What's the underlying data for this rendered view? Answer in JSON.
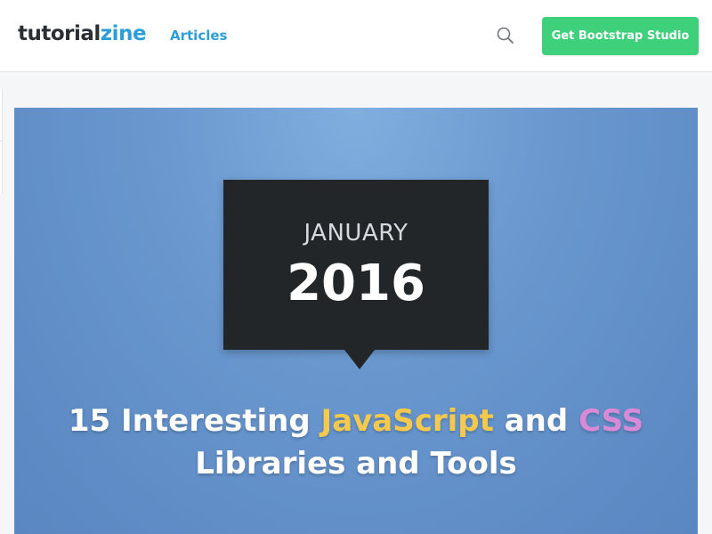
{
  "header": {
    "logo_part1": "tutorial",
    "logo_part2": "zine",
    "nav_articles": "Articles",
    "search_icon": "search-icon",
    "cta_label": "Get Bootstrap Studio"
  },
  "hero": {
    "month": "JANUARY",
    "year": "2016",
    "title_part1": "15 Interesting ",
    "title_js": "JavaScript",
    "title_part2": " and ",
    "title_css": "CSS",
    "title_line2": "Libraries and Tools"
  },
  "colors": {
    "brand_accent": "#2d9fd8",
    "cta_green": "#3fd07b",
    "hero_blue": "#6896cd",
    "date_box": "#232629",
    "js_highlight": "#f5c94b",
    "css_highlight": "#d98ad6"
  }
}
